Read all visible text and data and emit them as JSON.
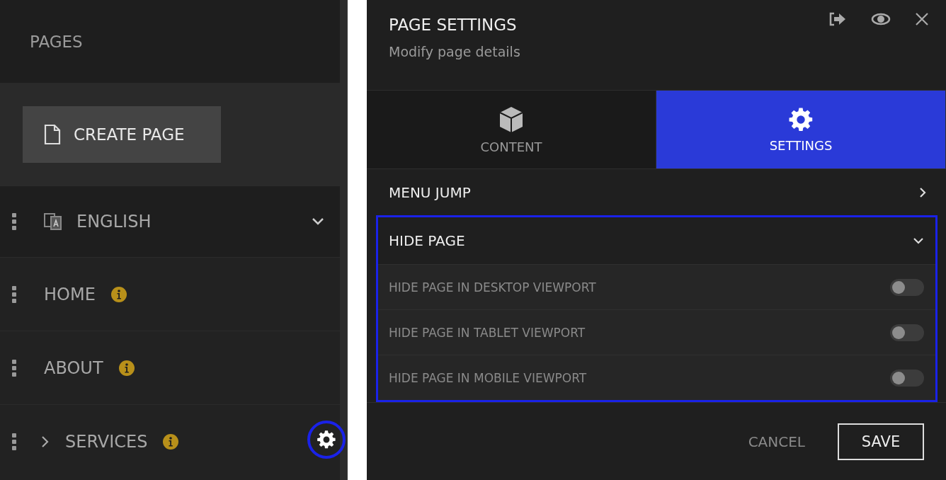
{
  "sidebar": {
    "title": "PAGES",
    "create_button": "CREATE PAGE",
    "items": [
      {
        "kind": "language",
        "label": "ENGLISH",
        "info": false,
        "selected": false
      },
      {
        "kind": "page",
        "label": "HOME",
        "info": true,
        "selected": false
      },
      {
        "kind": "page",
        "label": "ABOUT",
        "info": true,
        "selected": false
      },
      {
        "kind": "folder",
        "label": "SERVICES",
        "info": true,
        "selected": true
      }
    ]
  },
  "panel": {
    "title": "PAGE SETTINGS",
    "subtitle": "Modify page details",
    "tabs": [
      {
        "kind": "content",
        "label": "CONTENT",
        "selected": false
      },
      {
        "kind": "settings",
        "label": "SETTINGS",
        "selected": true
      }
    ],
    "sections": [
      {
        "label": "MENU JUMP",
        "expanded": false,
        "highlighted": false
      },
      {
        "label": "HIDE PAGE",
        "expanded": true,
        "highlighted": true,
        "options": [
          {
            "label": "HIDE PAGE IN DESKTOP VIEWPORT",
            "on": false
          },
          {
            "label": "HIDE PAGE IN TABLET VIEWPORT",
            "on": false
          },
          {
            "label": "HIDE PAGE IN MOBILE VIEWPORT",
            "on": false
          }
        ]
      }
    ],
    "cancel": "CANCEL",
    "save": "SAVE"
  }
}
